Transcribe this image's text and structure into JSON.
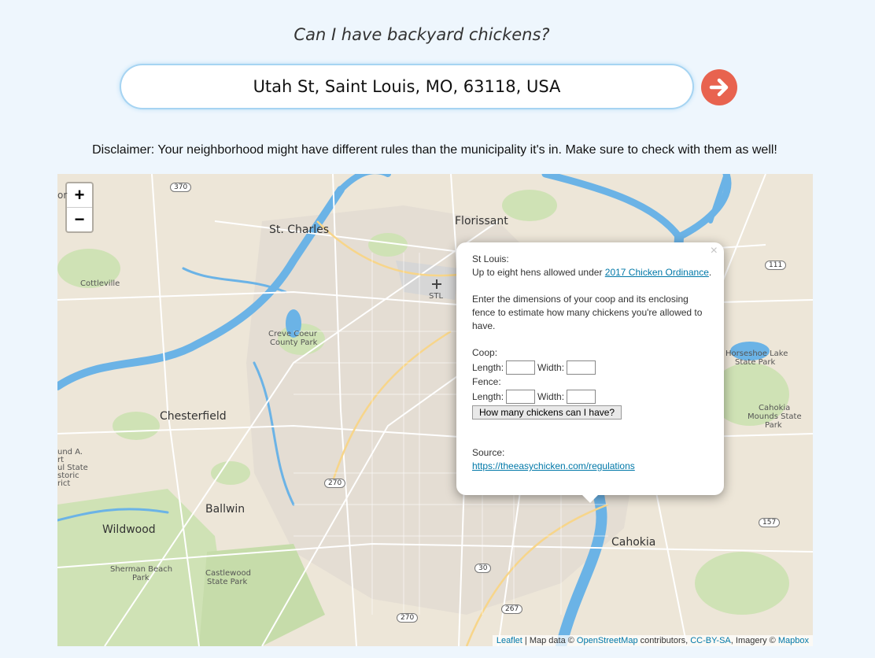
{
  "header": {
    "title": "Can I have backyard chickens?"
  },
  "search": {
    "value": "Utah St, Saint Louis, MO, 63118, USA",
    "go_icon": "arrow-right-circle-icon",
    "go_color": "#e8634f"
  },
  "disclaimer": "Disclaimer: Your neighborhood might have different rules than the municipality it's in. Make sure to check with them as well!",
  "map": {
    "zoom_in": "+",
    "zoom_out": "−",
    "labels": {
      "st_charles": "St. Charles",
      "florissant": "Florissant",
      "cottleville": "Cottleville",
      "creve_coeur": "Creve Coeur",
      "county_park": "County Park",
      "chesterfield": "Chesterfield",
      "ballwin": "Ballwin",
      "wildwood": "Wildwood",
      "sherman_beach": "Sherman Beach",
      "park": "Park",
      "castlewood": "Castlewood",
      "state_park": "State Park",
      "cahokia": "Cahokia",
      "horseshoe": "Horseshoe Lake",
      "horseshoe2": "State Park",
      "cahokia_mounds": "Cahokia",
      "cahokia_mounds2": "Mounds State",
      "cahokia_mounds3": "Park",
      "stl": "STL",
      "edge1": "or",
      "edge2": "und A.",
      "edge3": "rt",
      "edge4": "ul State",
      "edge5": "storic",
      "edge6": "rict"
    },
    "shields": [
      "370",
      "111",
      "270",
      "157",
      "30",
      "267",
      "270"
    ],
    "attribution": {
      "leaflet": "Leaflet",
      "sep1": " | Map data © ",
      "osm": "OpenStreetMap",
      "sep2": " contributors, ",
      "license": "CC-BY-SA",
      "sep3": ", Imagery © ",
      "mapbox": "Mapbox"
    }
  },
  "popup": {
    "close": "×",
    "place": "St Louis:",
    "rule_prefix": "Up to eight hens allowed under ",
    "rule_link": "2017 Chicken Ordinance",
    "rule_suffix": ".",
    "instructions": "Enter the dimensions of your coop and its enclosing fence to estimate how many chickens you're allowed to have.",
    "coop_label": "Coop:",
    "fence_label": "Fence:",
    "length_label": "Length:",
    "width_label": "Width:",
    "button": "How many chickens can I have?",
    "source_label": "Source:",
    "source_link": "https://theeasychicken.com/regulations"
  }
}
